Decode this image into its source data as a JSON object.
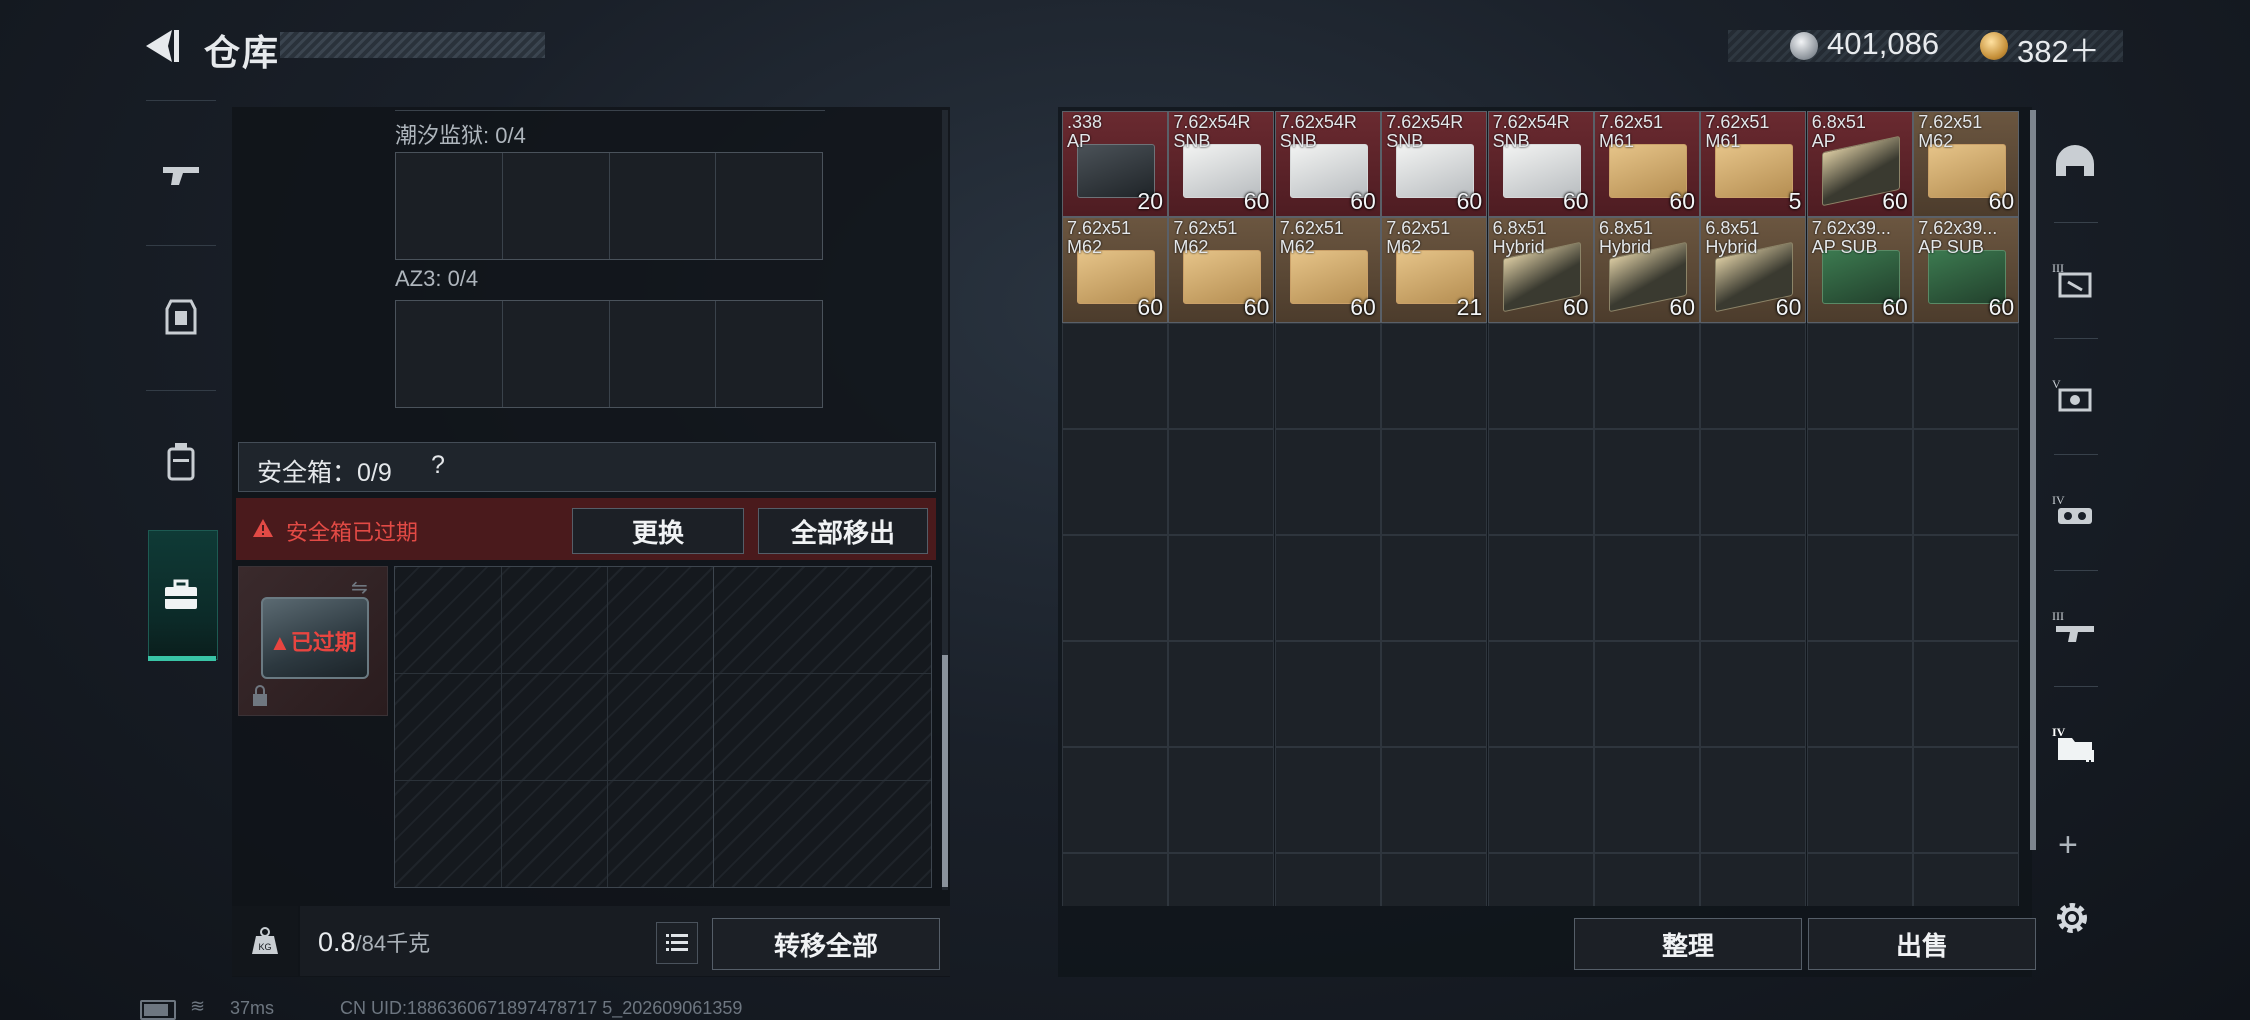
{
  "header": {
    "title": "仓库",
    "back_icon": "back-arrow-icon"
  },
  "currency": [
    {
      "icon": "silver-coin-icon",
      "value": "401,086"
    },
    {
      "icon": "gold-coin-icon",
      "value": "382＋"
    }
  ],
  "left_nav": {
    "items": [
      {
        "name": "weapons",
        "icon": "pistol-icon"
      },
      {
        "name": "armor",
        "icon": "armor-vest-icon"
      },
      {
        "name": "backpack",
        "icon": "backpack-icon"
      },
      {
        "name": "safe-case",
        "icon": "briefcase-icon",
        "active": true
      }
    ]
  },
  "containers": [
    {
      "label": "潮汐监狱: 0/4"
    },
    {
      "label": "AZ3: 0/4"
    }
  ],
  "safe_box": {
    "label": "安全箱：0/9",
    "help": "?",
    "warning": "安全箱已过期",
    "replace_button": "更换",
    "move_all_button": "全部移出",
    "expired_tag": "已过期",
    "swap_icon": "swap-icon",
    "lock_icon": "lock-icon"
  },
  "footer_left": {
    "weight_value": "0.8",
    "weight_max": "/84千克",
    "kg_icon": "weight-kg-icon",
    "list_icon": "list-icon",
    "transfer_button": "转移全部"
  },
  "status_bar": {
    "ping": "37ms",
    "uid": "CN UID:1886360671897478717 5_202609061359"
  },
  "inventory": {
    "items": [
      {
        "name": ".338\nAP",
        "qty": "20",
        "bg": "red",
        "box": "dark"
      },
      {
        "name": "7.62x54R\nSNB",
        "qty": "60",
        "bg": "red",
        "box": "white"
      },
      {
        "name": "7.62x54R\nSNB",
        "qty": "60",
        "bg": "red",
        "box": "white"
      },
      {
        "name": "7.62x54R\nSNB",
        "qty": "60",
        "bg": "red",
        "box": "white"
      },
      {
        "name": "7.62x54R\nSNB",
        "qty": "60",
        "bg": "red",
        "box": "white"
      },
      {
        "name": "7.62x51\nM61",
        "qty": "60",
        "bg": "red",
        "box": "tan"
      },
      {
        "name": "7.62x51\nM61",
        "qty": "5",
        "bg": "red",
        "box": "tan"
      },
      {
        "name": "6.8x51\nAP",
        "qty": "60",
        "bg": "red",
        "box": "hybrid"
      },
      {
        "name": "7.62x51\nM62",
        "qty": "60",
        "bg": "brown",
        "box": "tan"
      },
      {
        "name": "7.62x51\nM62",
        "qty": "60",
        "bg": "brown",
        "box": "tan"
      },
      {
        "name": "7.62x51\nM62",
        "qty": "60",
        "bg": "brown",
        "box": "tan"
      },
      {
        "name": "7.62x51\nM62",
        "qty": "60",
        "bg": "brown",
        "box": "tan"
      },
      {
        "name": "7.62x51\nM62",
        "qty": "21",
        "bg": "brown",
        "box": "tan"
      },
      {
        "name": "6.8x51\nHybrid",
        "qty": "60",
        "bg": "brown",
        "box": "hybrid"
      },
      {
        "name": "6.8x51\nHybrid",
        "qty": "60",
        "bg": "brown",
        "box": "hybrid"
      },
      {
        "name": "6.8x51\nHybrid",
        "qty": "60",
        "bg": "brown",
        "box": "hybrid"
      },
      {
        "name": "7.62x39...\nAP SUB",
        "qty": "60",
        "bg": "brown",
        "box": "ap"
      },
      {
        "name": "7.62x39...\nAP SUB",
        "qty": "60",
        "bg": "brown",
        "box": "ap"
      }
    ],
    "sort_button": "整理",
    "sell_button": "出售"
  },
  "right_nav": {
    "items": [
      {
        "name": "helmet",
        "icon": "helmet-icon"
      },
      {
        "name": "tier-3-equip",
        "icon": "tier-3-equipment-icon"
      },
      {
        "name": "tier-5-equip",
        "icon": "tier-5-equipment-icon"
      },
      {
        "name": "tier-4-equip",
        "icon": "tier-4-equipment-icon"
      },
      {
        "name": "tier-3-weapon",
        "icon": "tier-3-weapon-icon"
      },
      {
        "name": "tier-4-folder",
        "icon": "tier-4-folder-icon",
        "active": true
      }
    ],
    "add_icon": "plus-icon",
    "settings_icon": "gear-icon"
  },
  "colors": {
    "accent_green": "#39c4a6",
    "warning_red": "#e24a45",
    "item_red_bg": "#5a2228",
    "item_brown_bg": "#5c4a36"
  }
}
